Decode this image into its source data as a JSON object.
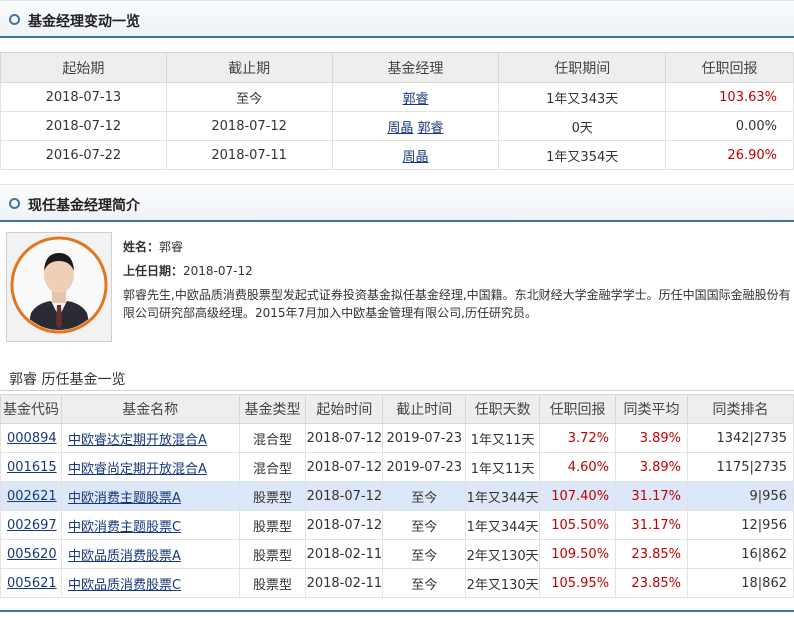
{
  "change_section": {
    "title": "基金经理变动一览"
  },
  "change_table": {
    "headers": [
      "起始期",
      "截止期",
      "基金经理",
      "任职期间",
      "任职回报"
    ],
    "rows": [
      {
        "start": "2018-07-13",
        "end": "至今",
        "managers": [
          "郭睿"
        ],
        "duration": "1年又343天",
        "return": "103.63%"
      },
      {
        "start": "2018-07-12",
        "end": "2018-07-12",
        "managers": [
          "周晶",
          "郭睿"
        ],
        "duration": "0天",
        "return": "0.00%"
      },
      {
        "start": "2016-07-22",
        "end": "2018-07-11",
        "managers": [
          "周晶"
        ],
        "duration": "1年又354天",
        "return": "26.90%"
      }
    ]
  },
  "intro_section": {
    "title": "现任基金经理简介"
  },
  "profile": {
    "name_label": "姓名：",
    "name": "郭睿",
    "date_label": "上任日期：",
    "date": "2018-07-12",
    "bio": "郭睿先生,中欧品质消费股票型发起式证券投资基金拟任基金经理,中国籍。东北财经大学金融学学士。历任中国国际金融股份有限公司研究部高级经理。2015年7月加入中欧基金管理有限公司,历任研究员。"
  },
  "history": {
    "title": "郭睿 历任基金一览",
    "headers": [
      "基金代码",
      "基金名称",
      "基金类型",
      "起始时间",
      "截止时间",
      "任职天数",
      "任职回报",
      "同类平均",
      "同类排名"
    ],
    "rows": [
      {
        "code": "000894",
        "name": "中欧睿达定期开放混合A",
        "type": "混合型",
        "start": "2018-07-12",
        "end": "2019-07-23",
        "days": "1年又11天",
        "return": "3.72%",
        "avg": "3.89%",
        "rank": "1342|2735"
      },
      {
        "code": "001615",
        "name": "中欧睿尚定期开放混合A",
        "type": "混合型",
        "start": "2018-07-12",
        "end": "2019-07-23",
        "days": "1年又11天",
        "return": "4.60%",
        "avg": "3.89%",
        "rank": "1175|2735"
      },
      {
        "code": "002621",
        "name": "中欧消费主题股票A",
        "type": "股票型",
        "start": "2018-07-12",
        "end": "至今",
        "days": "1年又344天",
        "return": "107.40%",
        "avg": "31.17%",
        "rank": "9|956"
      },
      {
        "code": "002697",
        "name": "中欧消费主题股票C",
        "type": "股票型",
        "start": "2018-07-12",
        "end": "至今",
        "days": "1年又344天",
        "return": "105.50%",
        "avg": "31.17%",
        "rank": "12|956"
      },
      {
        "code": "005620",
        "name": "中欧品质消费股票A",
        "type": "股票型",
        "start": "2018-02-11",
        "end": "至今",
        "days": "2年又130天",
        "return": "109.50%",
        "avg": "23.85%",
        "rank": "16|862"
      },
      {
        "code": "005621",
        "name": "中欧品质消费股票C",
        "type": "股票型",
        "start": "2018-02-11",
        "end": "至今",
        "days": "2年又130天",
        "return": "105.95%",
        "avg": "23.85%",
        "rank": "18|862"
      }
    ]
  },
  "colors": {
    "accent": "#3f73a8",
    "link": "#16387c",
    "positive": "#c00000",
    "highlight_row": "#dce8f8"
  }
}
